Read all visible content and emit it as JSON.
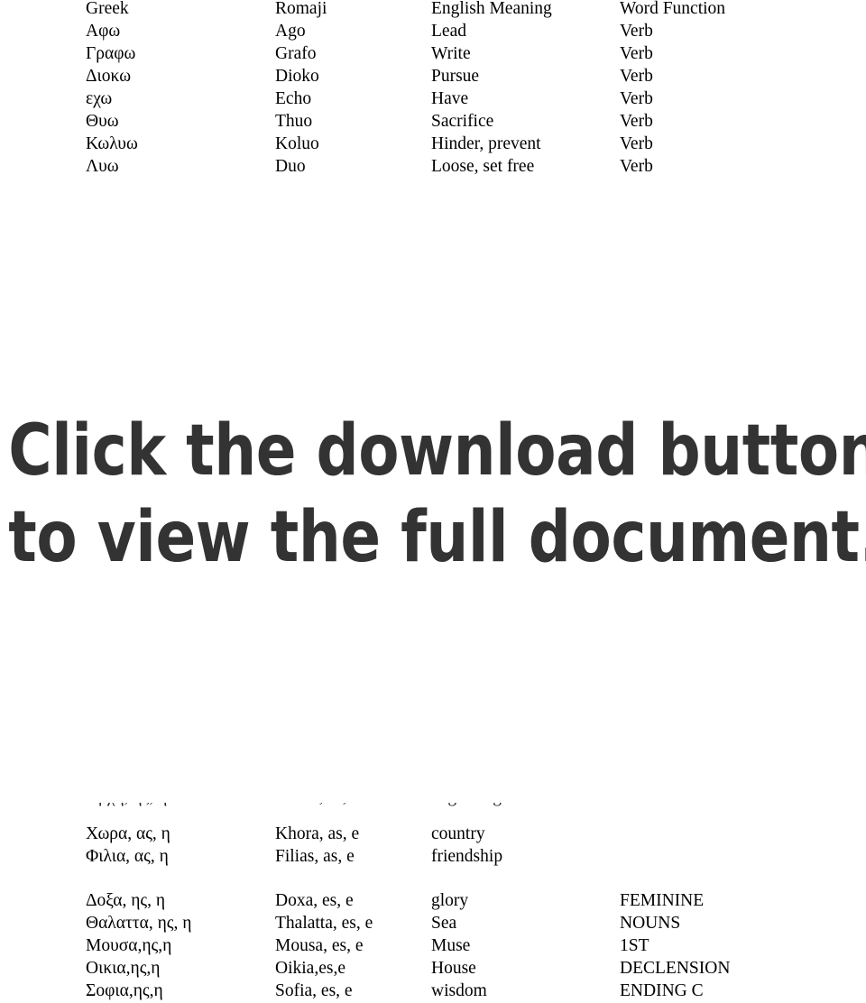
{
  "document": {
    "background_color": "#ffffff",
    "text_color": "#000000"
  },
  "verbs_table": {
    "headers": {
      "greek": "Greek",
      "romaji": "Romaji",
      "english": "English Meaning",
      "function": "Word Function"
    },
    "rows": [
      {
        "greek": "Αφω",
        "romaji": "Ago",
        "english": "Lead",
        "function": "Verb"
      },
      {
        "greek": "Γραφω",
        "romaji": "Grafo",
        "english": "Write",
        "function": "Verb"
      },
      {
        "greek": "Διοκω",
        "romaji": "Dioko",
        "english": "Pursue",
        "function": "Verb"
      },
      {
        "greek": "εχω",
        "romaji": "Echo",
        "english": "Have",
        "function": "Verb"
      },
      {
        "greek": "Θυω",
        "romaji": "Thuo",
        "english": "Sacrifice",
        "function": "Verb"
      },
      {
        "greek": "Κωλυω",
        "romaji": "Koluo",
        "english": "Hinder, prevent",
        "function": "Verb"
      },
      {
        "greek": "Λυω",
        "romaji": "Duo",
        "english": "Loose, set free",
        "function": "Verb"
      }
    ]
  },
  "callout": {
    "line1": "Click the download button",
    "line2": "to view the full document.",
    "color": "#333333"
  },
  "nouns_table": {
    "rows_group_a": [
      {
        "greek": "Χωρα, ας, η",
        "romaji": "Khora, as, e",
        "english": "country",
        "function": ""
      },
      {
        "greek": "Φιλια, ας, η",
        "romaji": "Filias, as, e",
        "english": "friendship",
        "function": ""
      }
    ],
    "rows_group_b": [
      {
        "greek": "Δοξα, ης, η",
        "romaji": "Doxa, es, e",
        "english": "glory",
        "function": "FEMININE"
      },
      {
        "greek": "Θαλαττα, ης, η",
        "romaji": "Thalatta, es, e",
        "english": "Sea",
        "function": "NOUNS"
      },
      {
        "greek": "Μουσα,ης,η",
        "romaji": "Mousa, es, e",
        "english": "Muse",
        "function": "1ST"
      },
      {
        "greek": "Οικια,ης,η",
        "romaji": "Oikia,es,e",
        "english": "House",
        "function": "DECLENSION"
      },
      {
        "greek": "Σοφια,ης,η",
        "romaji": "Sofia, es, e",
        "english": "wisdom",
        "function": "ENDING C"
      }
    ]
  }
}
